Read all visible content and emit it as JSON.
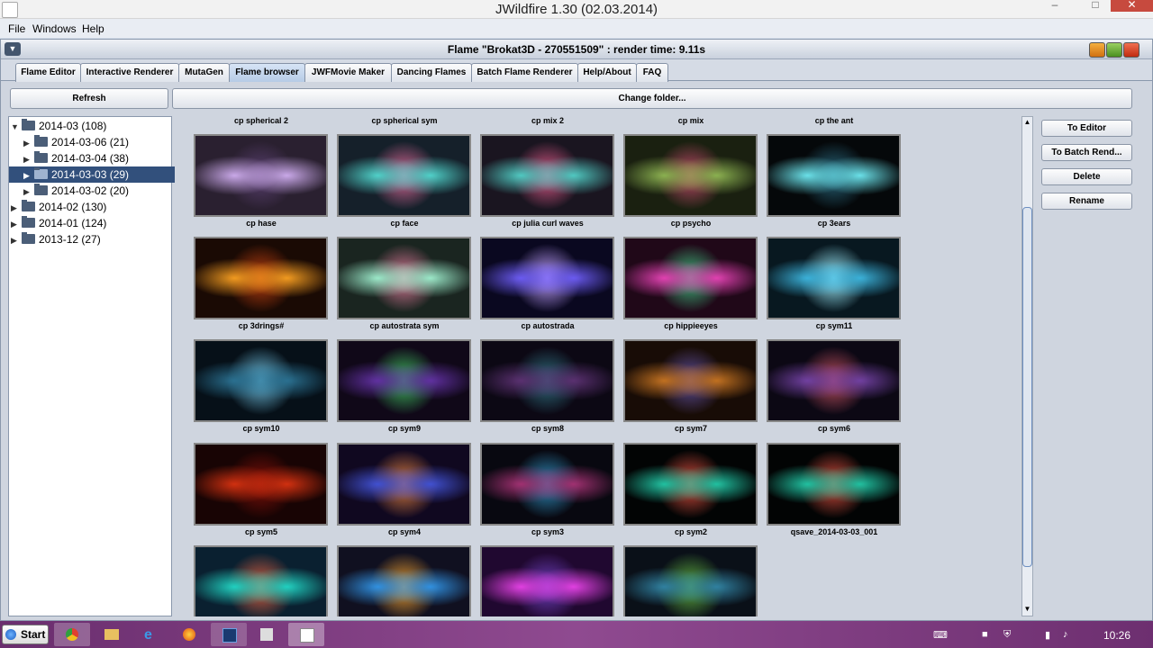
{
  "window": {
    "os_title": "JWildfire 1.30 (02.03.2014)",
    "os_controls": [
      "–",
      "□",
      "✕"
    ]
  },
  "menubar": [
    "File",
    "Windows",
    "Help"
  ],
  "frame": {
    "title": "Flame \"Brokat3D - 270551509\" : render time: 9.11s"
  },
  "tabs": [
    {
      "label": "Flame Editor"
    },
    {
      "label": "Interactive Renderer"
    },
    {
      "label": "MutaGen"
    },
    {
      "label": "Flame browser",
      "active": true
    },
    {
      "label": "JWFMovie Maker"
    },
    {
      "label": "Dancing Flames"
    },
    {
      "label": "Batch Flame Renderer"
    },
    {
      "label": "Help/About"
    },
    {
      "label": "FAQ"
    }
  ],
  "toolbar": {
    "refresh_label": "Refresh",
    "change_folder_label": "Change folder..."
  },
  "tree": [
    {
      "label": "2014-03 (108)",
      "expanded": true
    },
    {
      "label": "2014-03-06 (21)"
    },
    {
      "label": "2014-03-04 (38)"
    },
    {
      "label": "2014-03-03 (29)",
      "selected": true
    },
    {
      "label": "2014-03-02 (20)"
    },
    {
      "label": "2014-02 (130)"
    },
    {
      "label": "2014-01 (124)"
    },
    {
      "label": "2013-12 (27)"
    }
  ],
  "grid": {
    "top_labels": [
      "cp spherical 2",
      "cp spherical sym",
      "cp mix 2",
      "cp mix",
      "cp the ant"
    ],
    "rows": [
      [
        {
          "label": "cp hase",
          "colors": [
            "#2a2030",
            "#c9a8e8",
            "#5a4070"
          ]
        },
        {
          "label": "cp face",
          "colors": [
            "#15202a",
            "#4fd0c8",
            "#e06a9a"
          ]
        },
        {
          "label": "cp julia curl waves",
          "colors": [
            "#1a1520",
            "#4fc8c0",
            "#e05a8a"
          ]
        },
        {
          "label": "cp psycho",
          "colors": [
            "#1a2010",
            "#8ab050",
            "#c04a6a"
          ]
        },
        {
          "label": "cp 3ears",
          "colors": [
            "#05080a",
            "#6ae0e8",
            "#2a6a80"
          ]
        }
      ],
      [
        {
          "label": "cp 3drings#",
          "colors": [
            "#1a0a04",
            "#f09a20",
            "#c04010"
          ]
        },
        {
          "label": "cp autostrata sym",
          "colors": [
            "#1a2520",
            "#9ae8c8",
            "#e07a9a"
          ]
        },
        {
          "label": "cp autostrada",
          "colors": [
            "#0a0820",
            "#6a5af0",
            "#c0a0ff"
          ]
        },
        {
          "label": "cp hippieeyes",
          "colors": [
            "#200818",
            "#e040b0",
            "#40c080"
          ]
        },
        {
          "label": "cp sym11",
          "colors": [
            "#081820",
            "#3ab0d8",
            "#a0f0ff"
          ]
        }
      ],
      [
        {
          "label": "cp sym10",
          "colors": [
            "#061018",
            "#2a7090",
            "#70c0e0"
          ]
        },
        {
          "label": "cp sym9",
          "colors": [
            "#100818",
            "#6030a0",
            "#40c060"
          ]
        },
        {
          "label": "cp sym8",
          "colors": [
            "#0c0814",
            "#5a3070",
            "#307080"
          ]
        },
        {
          "label": "cp sym7",
          "colors": [
            "#180c06",
            "#c07020",
            "#6050a0"
          ]
        },
        {
          "label": "cp sym6",
          "colors": [
            "#0c0814",
            "#7040a0",
            "#c05060"
          ]
        }
      ],
      [
        {
          "label": "cp sym5",
          "colors": [
            "#180404",
            "#d03010",
            "#801008"
          ]
        },
        {
          "label": "cp sym4",
          "colors": [
            "#100820",
            "#4050d0",
            "#e08040"
          ]
        },
        {
          "label": "cp sym3",
          "colors": [
            "#080810",
            "#a03070",
            "#3090c0"
          ]
        },
        {
          "label": "cp sym2",
          "colors": [
            "#020404",
            "#20c0a0",
            "#e05040"
          ]
        },
        {
          "label": "qsave_2014-03-03_001",
          "colors": [
            "#020404",
            "#20c0a0",
            "#e05040"
          ]
        }
      ],
      [
        {
          "label": "",
          "colors": [
            "#0a2030",
            "#20d0c0",
            "#e06040"
          ]
        },
        {
          "label": "",
          "colors": [
            "#101020",
            "#3090e0",
            "#f0a030"
          ]
        },
        {
          "label": "",
          "colors": [
            "#200830",
            "#e040e0",
            "#7040c0"
          ]
        },
        {
          "label": "",
          "colors": [
            "#0a1018",
            "#3080a0",
            "#60b040"
          ]
        }
      ]
    ]
  },
  "side_buttons": [
    "To Editor",
    "To Batch Rend...",
    "Delete",
    "Rename"
  ],
  "taskbar": {
    "start_label": "Start",
    "items": [
      "chrome-icon",
      "explorer-icon",
      "ie-icon",
      "firefox-icon",
      "photoshop-icon",
      "zbrush-icon",
      "java-icon"
    ],
    "clock": "10:26"
  }
}
